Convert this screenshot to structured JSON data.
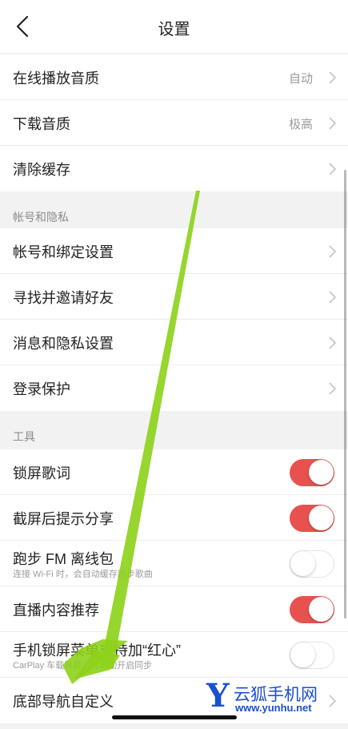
{
  "nav": {
    "title": "设置"
  },
  "groups": {
    "general": [
      {
        "label": "在线播放音质",
        "value": "自动"
      },
      {
        "label": "下载音质",
        "value": "极高"
      },
      {
        "label": "清除缓存"
      }
    ],
    "account": {
      "header": "帐号和隐私",
      "items": [
        {
          "label": "帐号和绑定设置"
        },
        {
          "label": "寻找并邀请好友"
        },
        {
          "label": "消息和隐私设置"
        },
        {
          "label": "登录保护"
        }
      ]
    },
    "tools": {
      "header": "工具",
      "items": [
        {
          "label": "锁屏歌词",
          "on": true
        },
        {
          "label": "截屏后提示分享",
          "on": true
        },
        {
          "label": "跑步 FM 离线包",
          "sub": "连接 Wi-Fi 时，会自动缓存跑步歌曲",
          "on": false
        },
        {
          "label": "直播内容推荐",
          "on": true
        },
        {
          "label": "手机锁屏菜单支持加“红心”",
          "sub": "CarPlay 车载屏幕上会自动开启同步",
          "on": false
        },
        {
          "label": "底部导航自定义"
        }
      ]
    }
  },
  "watermark": {
    "logo": "Y",
    "name": "云狐手机网",
    "url": "www.yunhu.net"
  },
  "colors": {
    "toggle_on": "#e8524e",
    "arrow": "#8ed21c"
  },
  "icons": {
    "back": "chevron-left-icon",
    "row": "chevron-right-icon"
  }
}
